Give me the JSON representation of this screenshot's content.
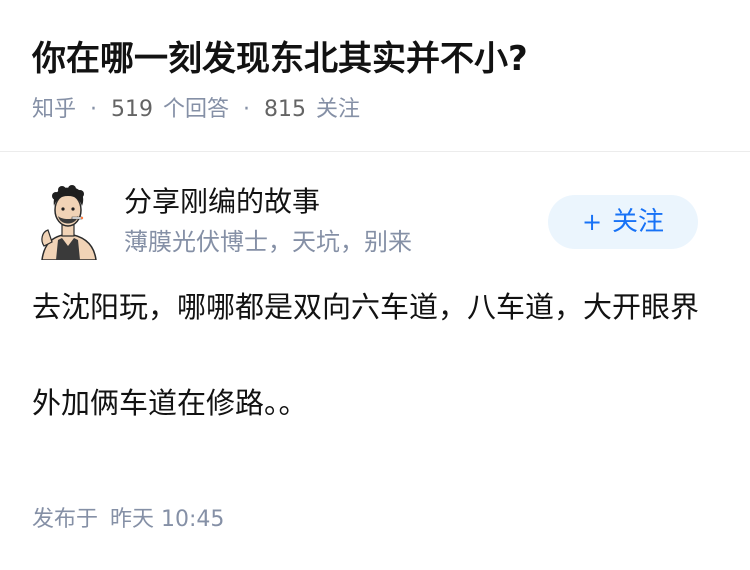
{
  "question": {
    "title": "你在哪一刻发现东北其实并不小?",
    "source": "知乎",
    "separator": "·",
    "answer_count": "519",
    "answer_label": "个回答",
    "follower_count": "815",
    "follower_label": "关注"
  },
  "author": {
    "name": "分享刚编的故事",
    "bio": "薄膜光伏博士，天坑，别来",
    "avatar_icon": "cartoon-person-avatar-icon"
  },
  "follow_button": {
    "plus": "+",
    "label": "关注",
    "bg_color": "#ebf5fd",
    "text_color": "#1772f6"
  },
  "answer": {
    "paragraphs": [
      "去沈阳玩，哪哪都是双向六车道，八车道，大开眼界",
      "外加俩车道在修路。。"
    ]
  },
  "published": {
    "label": "发布于",
    "time": "昨天 10:45"
  },
  "colors": {
    "title": "#121212",
    "meta": "#8590a6",
    "body": "#121212",
    "divider": "#ececec"
  }
}
